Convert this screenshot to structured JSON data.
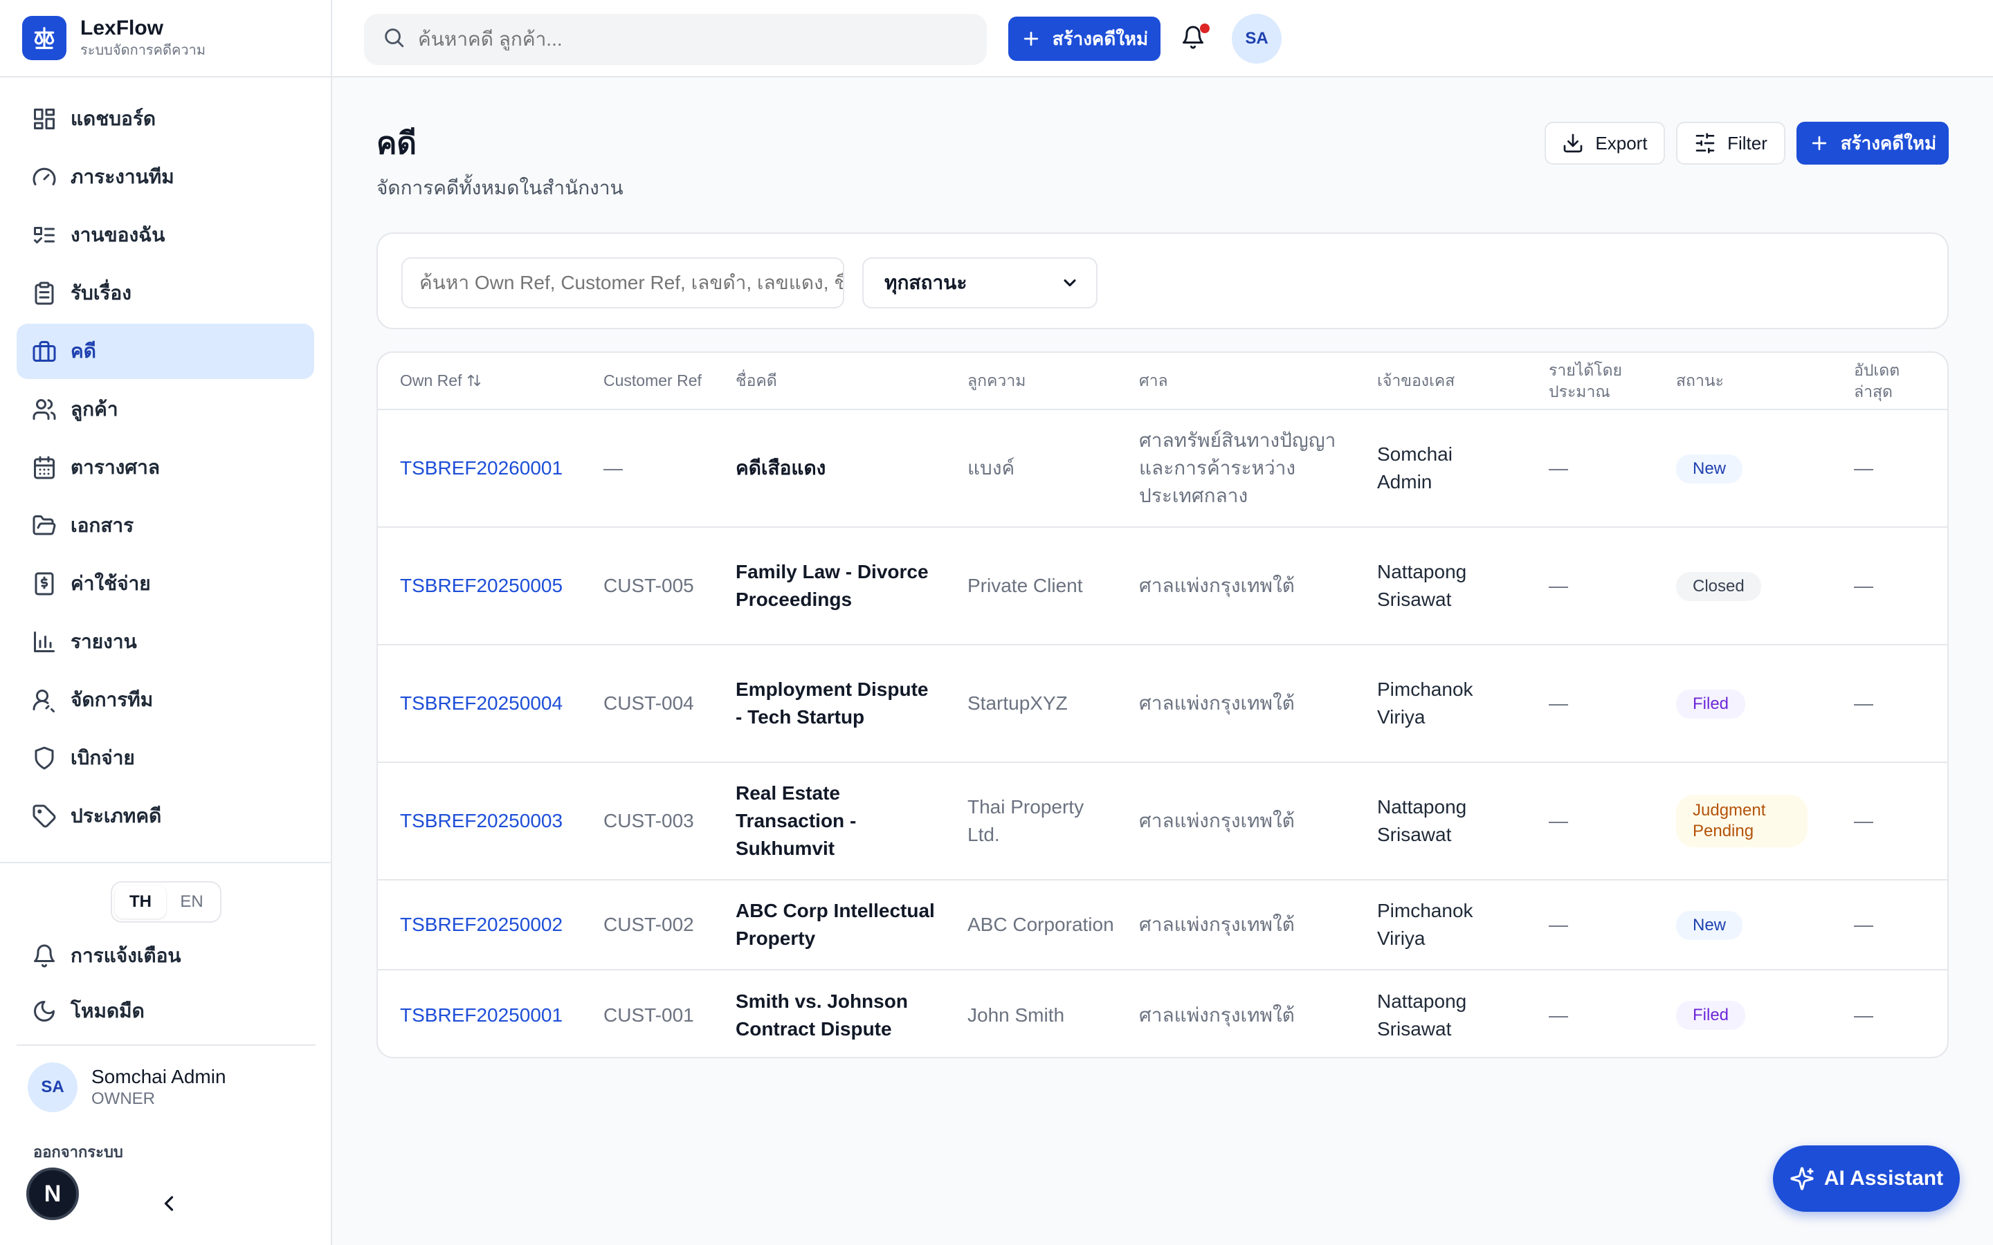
{
  "brand": {
    "name": "LexFlow",
    "subtitle": "ระบบจัดการคดีความ"
  },
  "topbar": {
    "search_placeholder": "ค้นหาคดี ลูกค้า...",
    "create_label": "สร้างคดีใหม่",
    "avatar_initials": "SA"
  },
  "nav": [
    {
      "label": "แดชบอร์ด",
      "icon": "dashboard-icon"
    },
    {
      "label": "ภาระงานทีม",
      "icon": "gauge-icon"
    },
    {
      "label": "งานของฉัน",
      "icon": "task-list-icon"
    },
    {
      "label": "รับเรื่อง",
      "icon": "clipboard-icon"
    },
    {
      "label": "คดี",
      "icon": "briefcase-icon",
      "active": true
    },
    {
      "label": "ลูกค้า",
      "icon": "users-icon"
    },
    {
      "label": "ตารางศาล",
      "icon": "calendar-icon"
    },
    {
      "label": "เอกสาร",
      "icon": "folder-icon"
    },
    {
      "label": "ค่าใช้จ่าย",
      "icon": "receipt-icon"
    },
    {
      "label": "รายงาน",
      "icon": "bar-chart-icon"
    },
    {
      "label": "จัดการทีม",
      "icon": "user-cog-icon"
    },
    {
      "label": "เบิกจ่าย",
      "icon": "shield-icon"
    },
    {
      "label": "ประเภทคดี",
      "icon": "tag-icon"
    }
  ],
  "language": {
    "th": "TH",
    "en": "EN",
    "selected": "TH"
  },
  "utility": {
    "notifications": "การแจ้งเตือน",
    "dark_mode": "โหมดมืด"
  },
  "user": {
    "initials": "SA",
    "name": "Somchai Admin",
    "role": "OWNER",
    "logout": "ออกจากระบบ",
    "badge": "N"
  },
  "page": {
    "title": "คดี",
    "subtitle": "จัดการคดีทั้งหมดในสำนักงาน",
    "export_label": "Export",
    "filter_label": "Filter",
    "create_label": "สร้างคดีใหม่"
  },
  "filters": {
    "search_placeholder": "ค้นหา Own Ref, Customer Ref, เลขดำ, เลขแดง, ชื่อคดี",
    "status_selected": "ทุกสถานะ"
  },
  "table": {
    "headers": {
      "own_ref": "Own Ref",
      "customer_ref": "Customer Ref",
      "case_name": "ชื่อคดี",
      "client": "ลูกความ",
      "court": "ศาล",
      "owner": "เจ้าของเคส",
      "revenue": "รายได้โดยประมาณ",
      "status": "สถานะ",
      "updated": "อัปเดตล่าสุด"
    },
    "rows": [
      {
        "own_ref": "TSBREF20260001",
        "customer_ref": "—",
        "case_name": "คดีเสือแดง",
        "client": "แบงค์",
        "court": "ศาลทรัพย์สินทางปัญญาและการค้าระหว่างประเทศกลาง",
        "owner": "Somchai Admin",
        "revenue": "—",
        "status": "New",
        "status_kind": "new",
        "updated": "—"
      },
      {
        "own_ref": "TSBREF20250005",
        "customer_ref": "CUST-005",
        "case_name": "Family Law - Divorce Proceedings",
        "client": "Private Client",
        "court": "ศาลแพ่งกรุงเทพใต้",
        "owner": "Nattapong Srisawat",
        "revenue": "—",
        "status": "Closed",
        "status_kind": "closed",
        "updated": "—"
      },
      {
        "own_ref": "TSBREF20250004",
        "customer_ref": "CUST-004",
        "case_name": "Employment Dispute - Tech Startup",
        "client": "StartupXYZ",
        "court": "ศาลแพ่งกรุงเทพใต้",
        "owner": "Pimchanok Viriya",
        "revenue": "—",
        "status": "Filed",
        "status_kind": "filed",
        "updated": "—"
      },
      {
        "own_ref": "TSBREF20250003",
        "customer_ref": "CUST-003",
        "case_name": "Real Estate Transaction - Sukhumvit",
        "client": "Thai Property Ltd.",
        "court": "ศาลแพ่งกรุงเทพใต้",
        "owner": "Nattapong Srisawat",
        "revenue": "—",
        "status": "Judgment Pending",
        "status_kind": "pending",
        "updated": "—"
      },
      {
        "own_ref": "TSBREF20250002",
        "customer_ref": "CUST-002",
        "case_name": "ABC Corp Intellectual Property",
        "client": "ABC Corporation",
        "court": "ศาลแพ่งกรุงเทพใต้",
        "owner": "Pimchanok Viriya",
        "revenue": "—",
        "status": "New",
        "status_kind": "new",
        "updated": "—"
      },
      {
        "own_ref": "TSBREF20250001",
        "customer_ref": "CUST-001",
        "case_name": "Smith vs. Johnson Contract Dispute",
        "client": "John Smith",
        "court": "ศาลแพ่งกรุงเทพใต้",
        "owner": "Nattapong Srisawat",
        "revenue": "—",
        "status": "Filed",
        "status_kind": "filed",
        "updated": "—"
      }
    ]
  },
  "assistant": {
    "label": "AI Assistant"
  },
  "colors": {
    "primary": "#1d4ed8",
    "active_bg": "#dbeafe",
    "border": "#e5e7eb",
    "notification_dot": "#dc2626"
  }
}
